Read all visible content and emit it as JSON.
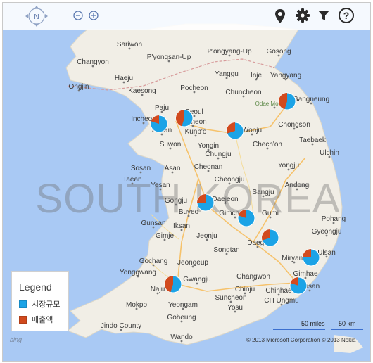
{
  "map": {
    "watermark": "SOUTH KOREA",
    "cities": [
      "Sariwon",
      "P'yongsan-Up",
      "P'ongyang-Up",
      "Gosong",
      "Changyon",
      "Haeju",
      "Yanggu",
      "Inje",
      "Yangyang",
      "Ongjin",
      "Kaesong",
      "Pocheon",
      "Chuncheon",
      "Gangneung",
      "Odae Mountain",
      "Paju",
      "Seoul",
      "Incheon",
      "Bucheon",
      "Ansan",
      "Kunp'o",
      "Wonju",
      "Chongson",
      "Suwon",
      "Yongin",
      "Chech'on",
      "Taebaek",
      "Chungju",
      "Ulchin",
      "Sosan",
      "Asan",
      "Cheonan",
      "Yongju",
      "Taean",
      "Yesan",
      "Cheongju",
      "Andong",
      "Sangju",
      "Gongju",
      "Daejeon",
      "Buyeo",
      "Gimcheon",
      "Gumi",
      "Pohang",
      "Gunsan",
      "Iksan",
      "Gimje",
      "Jeonju",
      "Gyeongju",
      "Daegu",
      "Songtan",
      "Ulsan",
      "Gochang",
      "Jeongeup",
      "Yonggwang",
      "Miryang",
      "Changwon",
      "Gimhae",
      "Naju",
      "Gwangju",
      "Busan",
      "Chinju",
      "Chinhae",
      "Mokpo",
      "Suncheon",
      "CH Ungmu",
      "Yeongam",
      "Yosu",
      "Jindo County",
      "Goheung",
      "Wando"
    ],
    "locations": [
      {
        "name": "Incheon",
        "share_red": 0.2
      },
      {
        "name": "Seoul",
        "share_red": 0.45
      },
      {
        "name": "Gangneung",
        "share_red": 0.45
      },
      {
        "name": "Wonju",
        "share_red": 0.3
      },
      {
        "name": "Daejeon",
        "share_red": 0.25
      },
      {
        "name": "Gimcheon",
        "share_red": 0.2
      },
      {
        "name": "Daegu",
        "share_red": 0.3
      },
      {
        "name": "Ulsan",
        "share_red": 0.25
      },
      {
        "name": "Gwangju",
        "share_red": 0.45
      },
      {
        "name": "Busan",
        "share_red": 0.2
      }
    ]
  },
  "legend": {
    "title": "Legend",
    "items": [
      {
        "label": "시장규모",
        "color": "#1ca3e6"
      },
      {
        "label": "매출액",
        "color": "#d14a1e"
      }
    ]
  },
  "scale": {
    "miles": "50 miles",
    "km": "50 km"
  },
  "copyright": "© 2013 Microsoft Corporation  © 2013 Nokia",
  "brand": "bing"
}
